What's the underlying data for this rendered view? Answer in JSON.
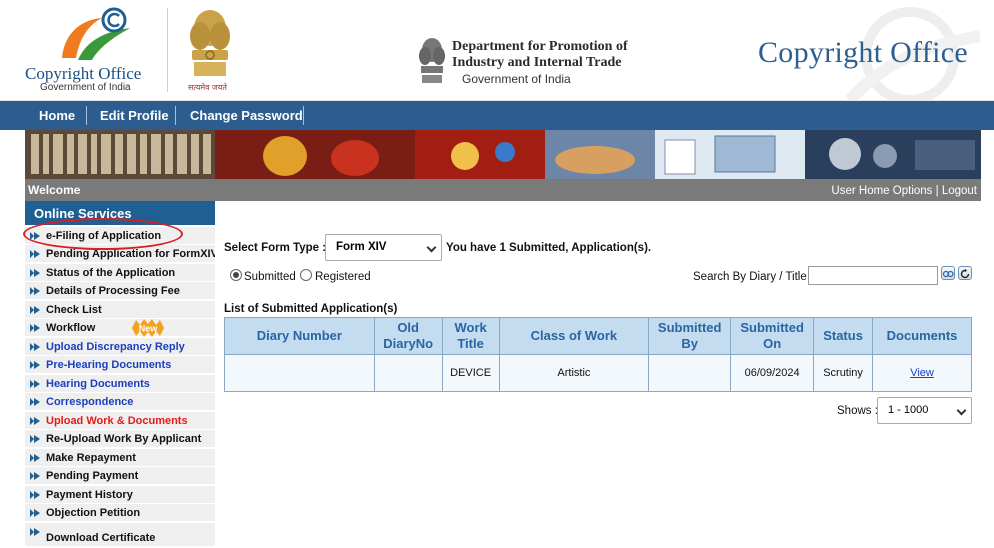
{
  "header": {
    "logo_title": "Copyright Office",
    "logo_subtitle": "Government of India",
    "emblem_caption": "सत्यमेव जयते",
    "dept_line1": "Department for Promotion of",
    "dept_line2": "Industry and Internal Trade",
    "dept_line3": "Government of India",
    "site_title": "Copyright Office"
  },
  "nav": {
    "items": [
      "Home",
      "Edit Profile",
      "Change Password"
    ]
  },
  "welcome": {
    "text": "Welcome",
    "links": [
      "User Home",
      "Options",
      "Logout"
    ]
  },
  "sidebar": {
    "title": "Online Services",
    "items": [
      {
        "label": "e-Filing of Application",
        "color": "#111111"
      },
      {
        "label": "Pending Application for FormXIV",
        "color": "#111111"
      },
      {
        "label": "Status of the Application",
        "color": "#111111"
      },
      {
        "label": "Details of Processing Fee",
        "color": "#111111"
      },
      {
        "label": "Check List",
        "color": "#111111"
      },
      {
        "label": "Workflow",
        "color": "#111111"
      },
      {
        "label": "Upload Discrepancy Reply",
        "color": "#1a3fc0"
      },
      {
        "label": "Pre-Hearing Documents",
        "color": "#1a3fc0"
      },
      {
        "label": "Hearing Documents",
        "color": "#1a3fc0"
      },
      {
        "label": "Correspondence",
        "color": "#1a3fc0"
      },
      {
        "label": "Upload Work & Documents",
        "color": "#e21b1b"
      },
      {
        "label": "Re-Upload Work By Applicant",
        "color": "#111111"
      },
      {
        "label": "Make Repayment",
        "color": "#111111"
      },
      {
        "label": "Pending Payment",
        "color": "#111111"
      },
      {
        "label": "Payment History",
        "color": "#111111"
      },
      {
        "label": "Objection Petition",
        "color": "#111111"
      },
      {
        "label": "Download Certificate",
        "color": "#111111"
      }
    ],
    "new_badge": "New"
  },
  "main": {
    "select_form_label": "Select Form Type :",
    "form_type_value": "Form XIV",
    "summary": "You have 1 Submitted, Application(s).",
    "radio_submitted": "Submitted",
    "radio_registered": "Registered",
    "search_label": "Search By Diary / Title :",
    "search_value": "",
    "list_title": "List of Submitted Application(s)",
    "table": {
      "headers": [
        "Diary Number",
        "Old DiaryNo",
        "Work Title",
        "Class of Work",
        "Submitted By",
        "Submitted On",
        "Status",
        "Documents"
      ],
      "rows": [
        [
          "",
          "",
          "DEVICE",
          "Artistic",
          "",
          "06/09/2024",
          "Scrutiny",
          "View"
        ]
      ]
    },
    "shows_label": "Shows :",
    "shows_value": "1 - 1000"
  },
  "colors": {
    "nav": "#2c5d8e",
    "sidebar_title": "#1f5f92",
    "table_header": "#c3dcf0",
    "welcome_bar": "#7a7a7a"
  }
}
